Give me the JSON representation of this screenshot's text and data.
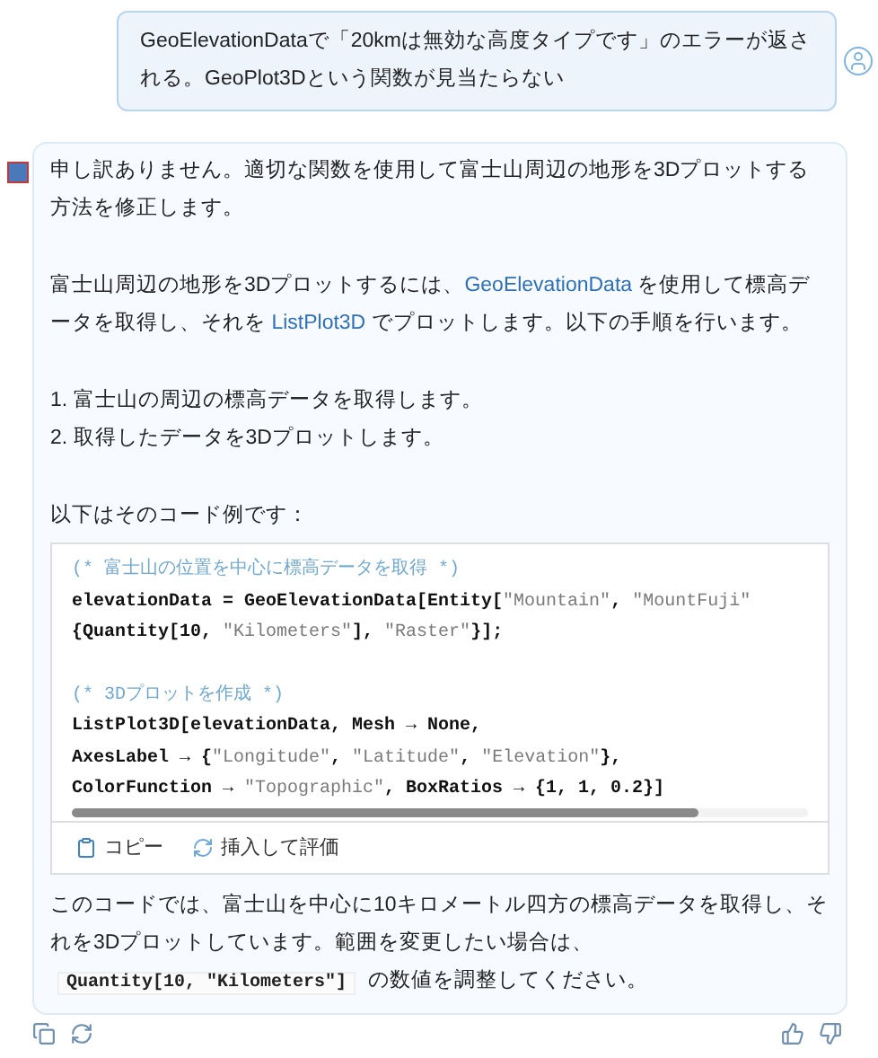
{
  "user_message": {
    "text": "GeoElevationDataで「20kmは無効な高度タイプです」のエラーが返される。GeoPlot3Dという関数が見当たらない"
  },
  "assistant_message": {
    "paragraphs": [
      [
        {
          "kind": "text",
          "text": "申し訳ありません。適切な関数を使用して富士山周辺の地形を3Dプロットする方法を修正します。"
        }
      ],
      [
        {
          "kind": "text",
          "text": "富士山周辺の地形を3Dプロットするには、"
        },
        {
          "kind": "link",
          "text": "GeoElevationData"
        },
        {
          "kind": "text",
          "text": " を使用して標高データを取得し、それを "
        },
        {
          "kind": "link",
          "text": "ListPlot3D"
        },
        {
          "kind": "text",
          "text": " でプロットします。以下の手順を行います。"
        }
      ],
      [
        {
          "kind": "text",
          "text": "1. 富士山の周辺の標高データを取得します。"
        }
      ],
      [
        {
          "kind": "text",
          "text": "2. 取得したデータを3Dプロットします。"
        }
      ],
      [
        {
          "kind": "text",
          "text": "以下はそのコード例です："
        }
      ]
    ],
    "code": {
      "blocks": [
        [
          [
            {
              "kind": "comment",
              "text": "(* 富士山の位置を中心に標高データを取得 *)"
            }
          ],
          [
            {
              "kind": "plain",
              "text": "elevationData = GeoElevationData[Entity["
            },
            {
              "kind": "string",
              "text": "\"Mountain\""
            },
            {
              "kind": "plain",
              "text": ", "
            },
            {
              "kind": "string",
              "text": "\"MountFuji\""
            }
          ],
          [
            {
              "kind": "plain",
              "text": "{Quantity[10, "
            },
            {
              "kind": "string",
              "text": "\"Kilometers\""
            },
            {
              "kind": "plain",
              "text": "], "
            },
            {
              "kind": "string",
              "text": "\"Raster\""
            },
            {
              "kind": "plain",
              "text": "}];"
            }
          ]
        ],
        [
          [
            {
              "kind": "comment",
              "text": "(* 3Dプロットを作成 *)"
            }
          ],
          [
            {
              "kind": "plain",
              "text": "ListPlot3D[elevationData, Mesh → None,"
            }
          ],
          [
            {
              "kind": "plain",
              "text": "AxesLabel → {"
            },
            {
              "kind": "string",
              "text": "\"Longitude\""
            },
            {
              "kind": "plain",
              "text": ", "
            },
            {
              "kind": "string",
              "text": "\"Latitude\""
            },
            {
              "kind": "plain",
              "text": ", "
            },
            {
              "kind": "string",
              "text": "\"Elevation\""
            },
            {
              "kind": "plain",
              "text": "},"
            }
          ],
          [
            {
              "kind": "plain",
              "text": "ColorFunction → "
            },
            {
              "kind": "string",
              "text": "\"Topographic\""
            },
            {
              "kind": "plain",
              "text": ", BoxRatios → {1, 1, 0.2}]"
            }
          ]
        ]
      ],
      "actions": [
        {
          "kind": "copy",
          "label": "コピー"
        },
        {
          "kind": "evaluate",
          "label": "挿入して評価"
        }
      ]
    },
    "closing": [
      {
        "kind": "text",
        "text": "このコードでは、富士山を中心に10キロメートル四方の標高データを取得し、それを3Dプロットしています。範囲を変更したい場合は、"
      },
      {
        "kind": "code",
        "text": "Quantity[10, \"Kilometers\"]"
      },
      {
        "kind": "text",
        "text": " の数値を調整してください。"
      }
    ]
  }
}
